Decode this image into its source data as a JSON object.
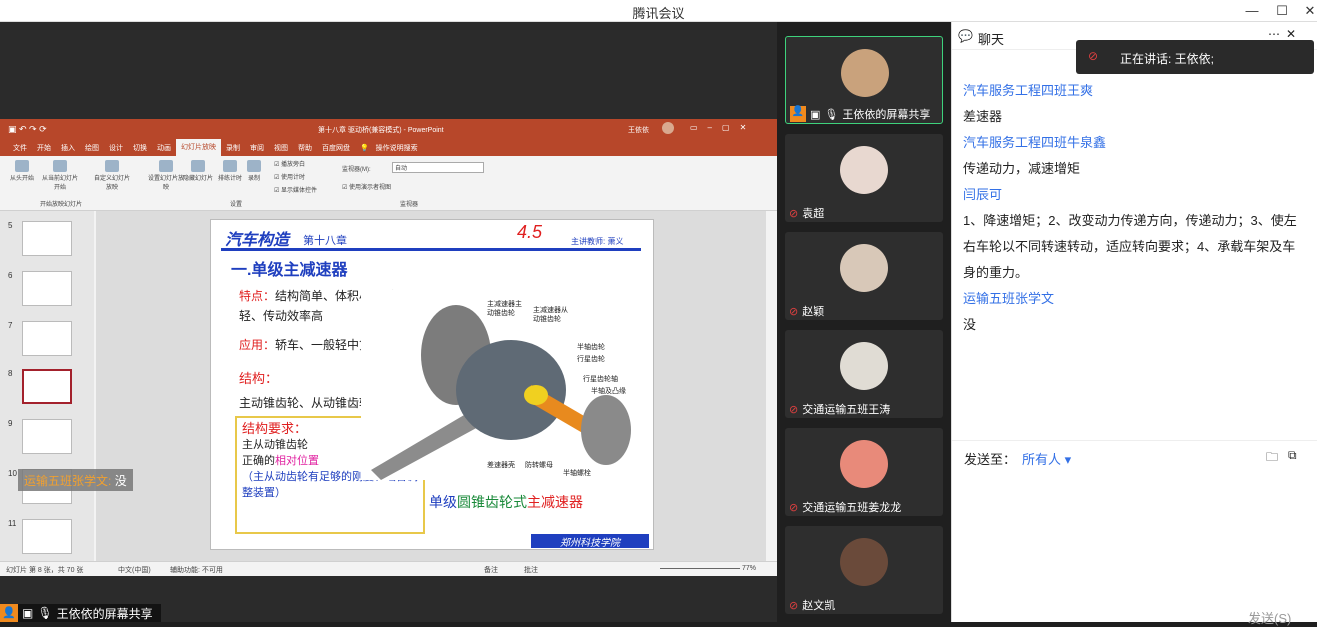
{
  "window": {
    "title": "腾讯会议"
  },
  "powerpoint": {
    "title": "第十八章 驱动桥(兼容模式) - PowerPoint",
    "user": "王依依",
    "tabs": [
      "文件",
      "开始",
      "插入",
      "绘图",
      "设计",
      "切换",
      "动画",
      "幻灯片放映",
      "录制",
      "审阅",
      "视图",
      "帮助",
      "百度网盘",
      "操作说明搜索"
    ],
    "active_tab_index": 7,
    "ribbon": {
      "from_start": "从头开始",
      "from_current": "从当前幻灯片开始",
      "custom": "自定义幻灯片放映",
      "group1": "开始放映幻灯片",
      "setup": "设置幻灯片放映",
      "hide": "隐藏幻灯片",
      "rehearse": "排练计时",
      "record": "录制",
      "cb_narration": "播放旁白",
      "cb_timing": "使用计时",
      "cb_controls": "显示媒体控件",
      "group2": "设置",
      "monitor_label": "监视器(M):",
      "monitor_value": "自动",
      "presenter": "使用演示者视图",
      "group3": "监视器"
    },
    "slide_numbers": [
      "5",
      "6",
      "7",
      "8",
      "9",
      "10",
      "11"
    ],
    "status": {
      "slide_info": "幻灯片 第 8 张，共 70 张",
      "lang": "中文(中国)",
      "accessibility": "辅助功能: 不可用",
      "notes": "备注",
      "comments": "批注",
      "zoom": "77%"
    },
    "slide": {
      "header": "汽车构造",
      "chapter": "第十八章",
      "handwriting": "4.5",
      "header_right": "主讲教师: 萧义",
      "heading": "一.单级主减速器",
      "feature_label": "特点：",
      "feature_text": "结构简单、体积小、质量轻、传动效率高",
      "app_label": "应用：",
      "app_text": "轿车、一般轻中货车",
      "struct_label": "结构：",
      "struct_text": "主动锥齿轮、从动锥齿轮、壳体",
      "req_title": "结构要求：",
      "req1": "主从动锥齿轮",
      "req2_a": "正确的",
      "req2_b": "相对位置",
      "req3": "（主从动齿轮有足够的刚度、啮合调整装置）",
      "caption_a": "单级",
      "caption_b": "圆锥齿轮式",
      "caption_c": "主减速器",
      "callouts": [
        "主减速器主动锥齿轮",
        "主减速器从动锥齿轮",
        "半轴齿轮",
        "行星齿轮",
        "行星齿轮轴",
        "半轴及凸缘",
        "差速器壳",
        "防转螺母",
        "半轴螺栓"
      ],
      "logo": "郑州科技学院"
    },
    "overlay_chat": {
      "name": "运输五班张学文:",
      "text": "没"
    }
  },
  "share_label": "王依依的屏幕共享",
  "participants": [
    {
      "name": "王依依的屏幕共享",
      "active": true
    },
    {
      "name": "袁超"
    },
    {
      "name": "赵颖"
    },
    {
      "name": "交通运输五班王涛"
    },
    {
      "name": "交通运输五班姜龙龙"
    },
    {
      "name": "赵文凯"
    }
  ],
  "chat": {
    "title": "聊天",
    "speaking": "正在讲话: 王依依;",
    "messages": [
      {
        "name": "汽车服务工程四班王爽",
        "lines": [
          "差速器"
        ]
      },
      {
        "name": "汽车服务工程四班牛泉鑫",
        "lines": [
          "传递动力，减速增矩"
        ]
      },
      {
        "name": "闫辰可",
        "lines": [
          "1、降速增矩；2、改变动力传递方向，传递动力；3、使左",
          "右车轮以不同转速转动，适应转向要求；4、承载车架及车",
          "身的重力。"
        ]
      },
      {
        "name": "运输五班张学文",
        "lines": [
          "没"
        ]
      }
    ],
    "send_to_label": "发送至：",
    "send_to_value": "所有人",
    "send_button": "发送(S)"
  },
  "colors": {
    "ppt_accent": "#b7472a",
    "chat_name": "#3370e6",
    "active_border": "#3ed27c"
  }
}
